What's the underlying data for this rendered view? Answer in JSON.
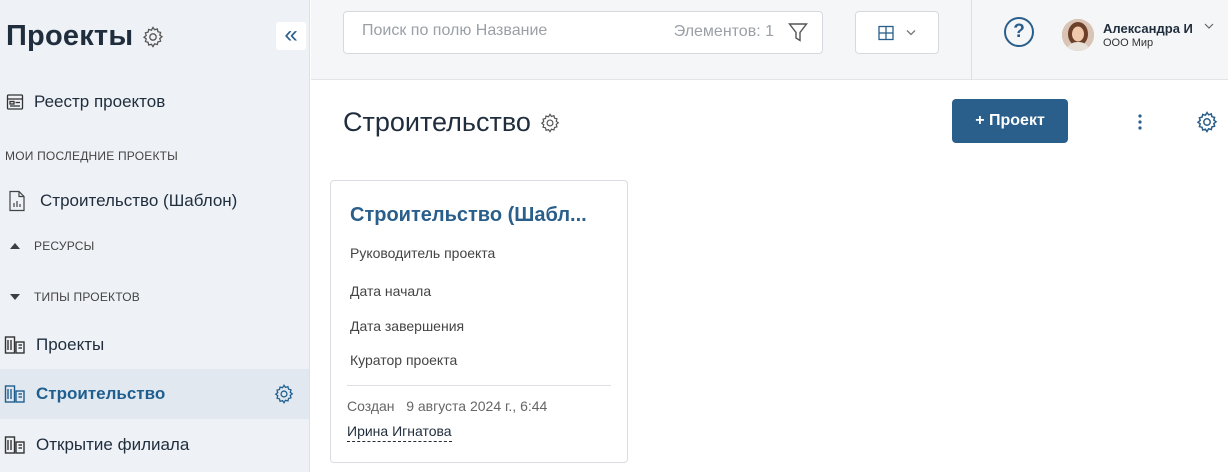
{
  "sidebar": {
    "title": "Проекты",
    "collapse_label": "«",
    "registry_label": "Реестр проектов",
    "recent_header": "МОИ ПОСЛЕДНИЕ ПРОЕКТЫ",
    "recent_items": [
      {
        "label": "Строительство (Шаблон)"
      }
    ],
    "resources_header": "РЕСУРСЫ",
    "types_header": "ТИПЫ ПРОЕКТОВ",
    "types": [
      {
        "label": "Проекты"
      },
      {
        "label": "Строительство"
      },
      {
        "label": "Открытие филиала"
      }
    ]
  },
  "header": {
    "search_placeholder": "Поиск по полю Название",
    "count_text": "Элементов: 1",
    "help_label": "?",
    "user_name": "Александра И",
    "user_org": "ООО Мир"
  },
  "main": {
    "title": "Строительство",
    "add_button": "+ Проект"
  },
  "card": {
    "title": "Строительство (Шабл...",
    "fields": [
      "Руководитель проекта",
      "Дата начала",
      "Дата завершения",
      "Куратор проекта"
    ],
    "created": "Создан   9 августа 2024 г., 6:44",
    "author": "Ирина Игнатова"
  },
  "colors": {
    "accent": "#2a5f8c",
    "sidebar_bg": "#eef1f5",
    "active_bg": "#e1e8f0"
  }
}
